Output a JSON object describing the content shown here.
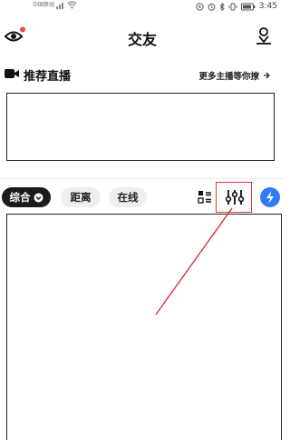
{
  "status_bar": {
    "carrier": "中国移动",
    "time": "3:45"
  },
  "header": {
    "title": "交友",
    "eye_icon": "eye-icon",
    "profile_icon": "location-person-icon",
    "badge_color": "#e84b4b"
  },
  "live": {
    "title": "推荐直播",
    "more_link": "更多主播等你撩",
    "more_icon": "chevron-right-icon"
  },
  "filters": {
    "active": "综合",
    "distance": "距离",
    "online": "在线",
    "active_icon": "chevron-down-icon",
    "list_icon": "list-grid-icon",
    "filter_icon": "sliders-icon",
    "flash_icon": "lightning-icon",
    "flash_color": "#2f7cf6"
  },
  "annotation": {
    "color": "#e23a3a"
  }
}
